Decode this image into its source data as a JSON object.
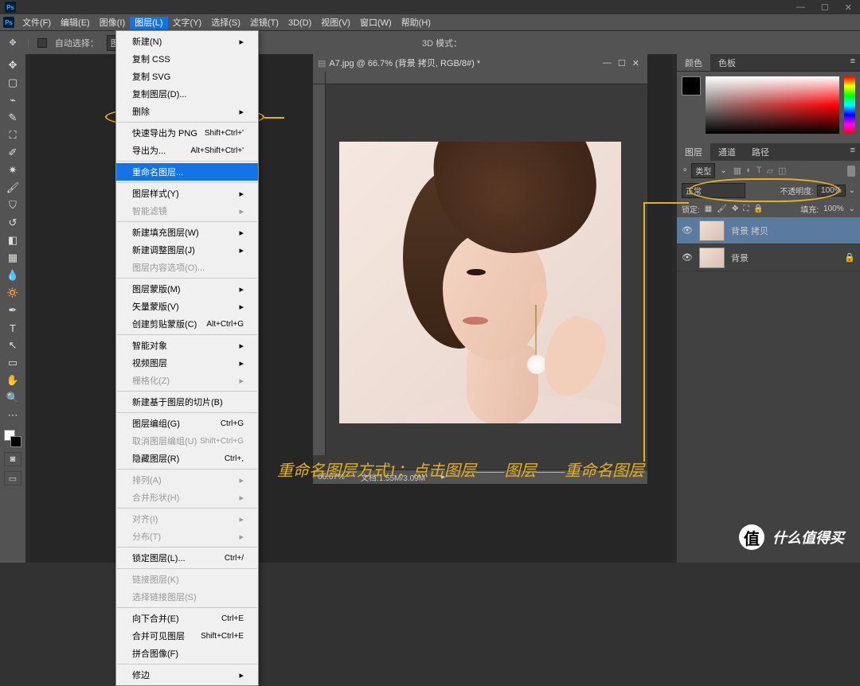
{
  "window_controls": {
    "min": "—",
    "max": "☐",
    "close": "✕"
  },
  "menubar": [
    "文件(F)",
    "编辑(E)",
    "图像(I)",
    "图层(L)",
    "文字(Y)",
    "选择(S)",
    "滤镜(T)",
    "3D(D)",
    "视图(V)",
    "窗口(W)",
    "帮助(H)"
  ],
  "menubar_active_index": 3,
  "optbar": {
    "auto_select_label": "自动选择：",
    "auto_select_value": "图层",
    "mode_3d": "3D 模式："
  },
  "dropdown": {
    "sections": [
      [
        {
          "label": "新建(N)",
          "sub": true
        },
        {
          "label": "复制 CSS"
        },
        {
          "label": "复制 SVG"
        },
        {
          "label": "复制图层(D)..."
        },
        {
          "label": "删除",
          "sub": true
        }
      ],
      [
        {
          "label": "快速导出为 PNG",
          "shortcut": "Shift+Ctrl+'"
        },
        {
          "label": "导出为...",
          "shortcut": "Alt+Shift+Ctrl+'"
        }
      ],
      [
        {
          "label": "重命名图层...",
          "highlight": true
        }
      ],
      [
        {
          "label": "图层样式(Y)",
          "sub": true
        },
        {
          "label": "智能滤镜",
          "disabled": true,
          "sub": true
        }
      ],
      [
        {
          "label": "新建填充图层(W)",
          "sub": true
        },
        {
          "label": "新建调整图层(J)",
          "sub": true
        },
        {
          "label": "图层内容选项(O)...",
          "disabled": true
        }
      ],
      [
        {
          "label": "图层蒙版(M)",
          "sub": true
        },
        {
          "label": "矢量蒙版(V)",
          "sub": true
        },
        {
          "label": "创建剪贴蒙版(C)",
          "shortcut": "Alt+Ctrl+G"
        }
      ],
      [
        {
          "label": "智能对象",
          "sub": true
        },
        {
          "label": "视频图层",
          "sub": true
        },
        {
          "label": "栅格化(Z)",
          "disabled": true,
          "sub": true
        }
      ],
      [
        {
          "label": "新建基于图层的切片(B)"
        }
      ],
      [
        {
          "label": "图层编组(G)",
          "shortcut": "Ctrl+G"
        },
        {
          "label": "取消图层编组(U)",
          "shortcut": "Shift+Ctrl+G",
          "disabled": true
        },
        {
          "label": "隐藏图层(R)",
          "shortcut": "Ctrl+,"
        }
      ],
      [
        {
          "label": "排列(A)",
          "disabled": true,
          "sub": true
        },
        {
          "label": "合并形状(H)",
          "disabled": true,
          "sub": true
        }
      ],
      [
        {
          "label": "对齐(I)",
          "disabled": true,
          "sub": true
        },
        {
          "label": "分布(T)",
          "disabled": true,
          "sub": true
        }
      ],
      [
        {
          "label": "锁定图层(L)...",
          "shortcut": "Ctrl+/"
        }
      ],
      [
        {
          "label": "链接图层(K)",
          "disabled": true
        },
        {
          "label": "选择链接图层(S)",
          "disabled": true
        }
      ],
      [
        {
          "label": "向下合并(E)",
          "shortcut": "Ctrl+E"
        },
        {
          "label": "合并可见图层",
          "shortcut": "Shift+Ctrl+E"
        },
        {
          "label": "拼合图像(F)"
        }
      ],
      [
        {
          "label": "修边",
          "sub": true
        }
      ]
    ]
  },
  "document": {
    "title": "A7.jpg @ 66.7% (背景 拷贝, RGB/8#) *",
    "zoom": "66.67%",
    "doc_info_label": "文档:",
    "doc_info": "1.55M/3.09M"
  },
  "panels": {
    "color_tabs": [
      "颜色",
      "色板"
    ],
    "layers_tabs": [
      "图层",
      "通道",
      "路径"
    ],
    "kind_label": "类型",
    "blend_mode": "正常",
    "opacity_label": "不透明度:",
    "opacity_value": "100%",
    "lock_label": "锁定:",
    "fill_label": "填充:",
    "fill_value": "100%",
    "layers": [
      {
        "name": "背景 拷贝",
        "selected": true,
        "visible": true,
        "locked": false
      },
      {
        "name": "背景",
        "selected": false,
        "visible": true,
        "locked": true
      }
    ]
  },
  "annotation": "重命名图层方式1：点击图层——图层——重命名图层",
  "watermark": {
    "badge": "值",
    "text": "什么值得买"
  }
}
